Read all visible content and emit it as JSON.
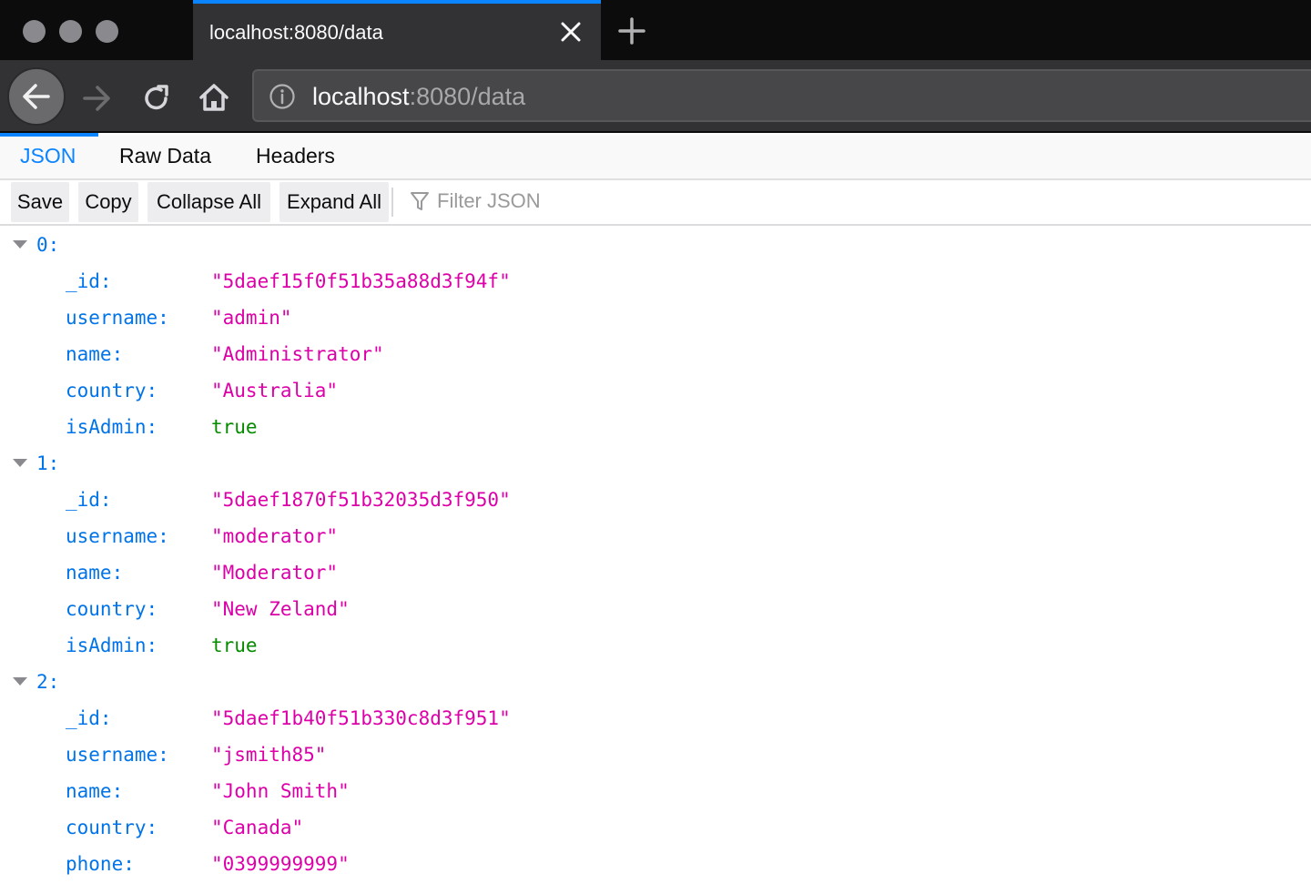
{
  "browser": {
    "tab_title": "localhost:8080/data",
    "url_host": "localhost",
    "url_rest": ":8080/data",
    "accent_color": "#0a84ff"
  },
  "viewer": {
    "tabs": [
      {
        "label": "JSON",
        "active": true
      },
      {
        "label": "Raw Data",
        "active": false
      },
      {
        "label": "Headers",
        "active": false
      }
    ],
    "toolbar": {
      "save_label": "Save",
      "copy_label": "Copy",
      "collapse_label": "Collapse All",
      "expand_label": "Expand All",
      "filter_placeholder": "Filter JSON"
    }
  },
  "json": [
    {
      "index": "0:",
      "fields": [
        {
          "key": "_id:",
          "value": "\"5daef15f0f51b35a88d3f94f\"",
          "type": "string"
        },
        {
          "key": "username:",
          "value": "\"admin\"",
          "type": "string"
        },
        {
          "key": "name:",
          "value": "\"Administrator\"",
          "type": "string"
        },
        {
          "key": "country:",
          "value": "\"Australia\"",
          "type": "string"
        },
        {
          "key": "isAdmin:",
          "value": "true",
          "type": "bool"
        }
      ]
    },
    {
      "index": "1:",
      "fields": [
        {
          "key": "_id:",
          "value": "\"5daef1870f51b32035d3f950\"",
          "type": "string"
        },
        {
          "key": "username:",
          "value": "\"moderator\"",
          "type": "string"
        },
        {
          "key": "name:",
          "value": "\"Moderator\"",
          "type": "string"
        },
        {
          "key": "country:",
          "value": "\"New Zeland\"",
          "type": "string"
        },
        {
          "key": "isAdmin:",
          "value": "true",
          "type": "bool"
        }
      ]
    },
    {
      "index": "2:",
      "fields": [
        {
          "key": "_id:",
          "value": "\"5daef1b40f51b330c8d3f951\"",
          "type": "string"
        },
        {
          "key": "username:",
          "value": "\"jsmith85\"",
          "type": "string"
        },
        {
          "key": "name:",
          "value": "\"John Smith\"",
          "type": "string"
        },
        {
          "key": "country:",
          "value": "\"Canada\"",
          "type": "string"
        },
        {
          "key": "phone:",
          "value": "\"0399999999\"",
          "type": "string"
        }
      ]
    }
  ]
}
